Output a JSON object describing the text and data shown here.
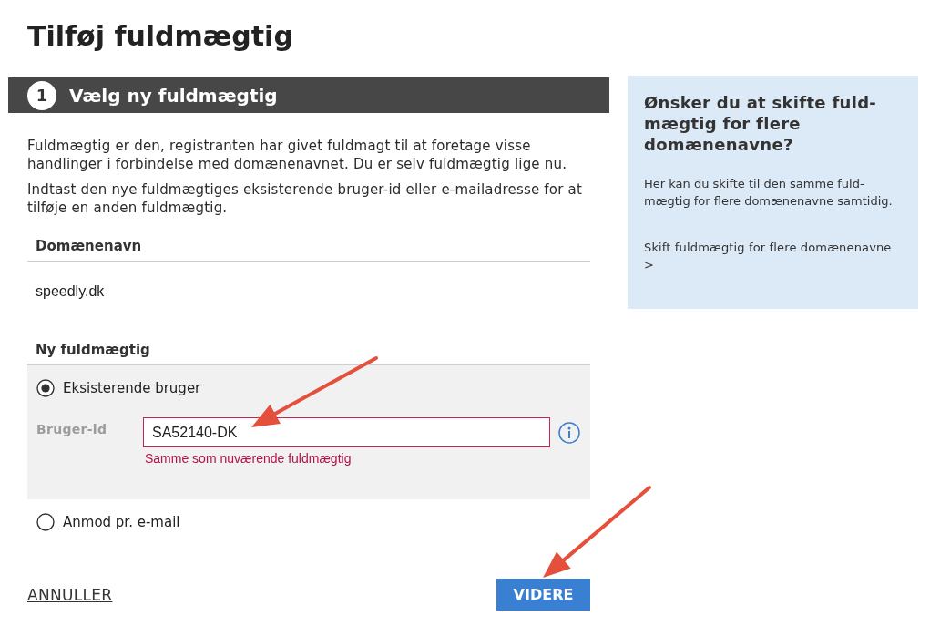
{
  "page": {
    "title": "Tilføj fuldmægtig"
  },
  "step": {
    "number": "1",
    "title": "Vælg ny fuldmægtig"
  },
  "intro": [
    "Fuldmægtig er den, registranten har givet fuldmagt til at foretage visse handlinger i forbindelse med domænenavnet. Du er selv fuldmægtig lige nu.",
    "Indtast den nye fuldmægtiges eksisterende bruger-id eller e-mailadresse for at tilføje en anden fuldmægtig."
  ],
  "domain_section": {
    "heading": "Domænenavn",
    "value": "speedly.dk"
  },
  "new_proxy_section": {
    "heading": "Ny fuldmægtig",
    "options": [
      {
        "label": "Eksisterende bruger",
        "selected": true,
        "field": {
          "label": "Bruger-id",
          "value": "SA52140-DK",
          "error": "Samme som nuværende fuldmægtig"
        }
      },
      {
        "label": "Anmod pr. e-mail",
        "selected": false
      }
    ]
  },
  "actions": {
    "cancel": "ANNULLER",
    "continue": "VIDERE"
  },
  "sidebar": {
    "heading": "Ønsker du at skifte fuld-mægtig for flere domænenavne?",
    "text": "Her kan du skifte til den samme fuld-mægtig for flere domænenavne samtidig.",
    "link": "Skift fuldmægtig for flere domænenavne >"
  }
}
